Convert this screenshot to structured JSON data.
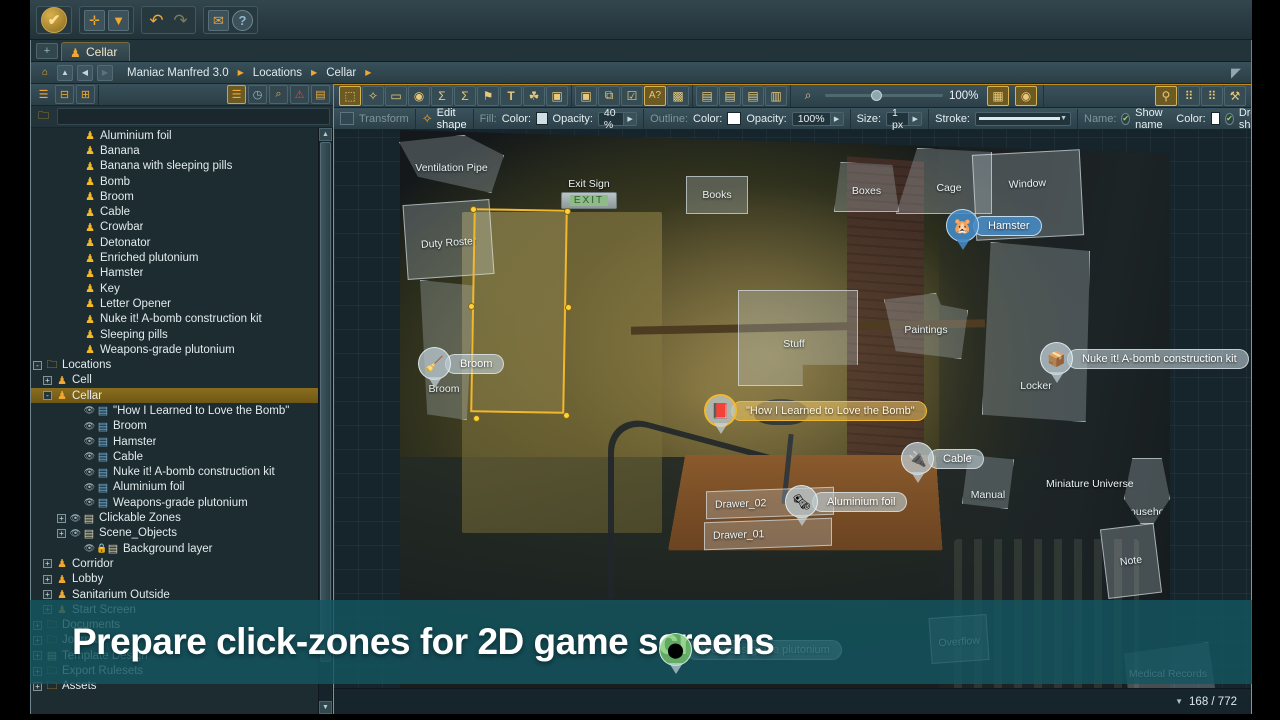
{
  "titlebar": {
    "buttons": [
      {
        "name": "apply-button",
        "glyph": "✔"
      },
      {
        "name": "new-button",
        "glyph": "✚"
      },
      {
        "name": "save-button",
        "glyph": "▼"
      },
      {
        "name": "undo-button",
        "glyph": "↶"
      },
      {
        "name": "redo-button",
        "glyph": "↷"
      },
      {
        "name": "mail-button",
        "glyph": "✉"
      },
      {
        "name": "help-button",
        "glyph": "?"
      }
    ]
  },
  "tabs": {
    "add_label": "+",
    "items": [
      {
        "label": "Cellar",
        "active": true
      }
    ]
  },
  "breadcrumb": {
    "home": "⌂",
    "up": "▲",
    "back": "◀",
    "forward": "▶",
    "segments": [
      "Maniac Manfred 3.0",
      "Locations",
      "Cellar"
    ],
    "arrow": "▶",
    "right_icon": "signal-icon"
  },
  "left_panel": {
    "toolbar_left": [
      "list-indent-icon",
      "list-collapse-icon",
      "list-expand-icon"
    ],
    "toolbar_right": [
      {
        "name": "filter-list-icon",
        "glyph": "☰",
        "selected": true
      },
      {
        "name": "clock-icon",
        "glyph": "◷",
        "selected": false
      },
      {
        "name": "search-icon",
        "glyph": "🔍",
        "selected": false
      },
      {
        "name": "warning-icon",
        "glyph": "⚠",
        "selected": false
      },
      {
        "name": "grid-icon",
        "glyph": "▤",
        "selected": false
      }
    ],
    "row2_icon": "folder-icon",
    "tree": [
      {
        "label": "Aluminium foil",
        "indent": 3,
        "icon": "item",
        "toggle": "none"
      },
      {
        "label": "Banana",
        "indent": 3,
        "icon": "item",
        "toggle": "none"
      },
      {
        "label": "Banana with sleeping pills",
        "indent": 3,
        "icon": "item",
        "toggle": "none"
      },
      {
        "label": "Bomb",
        "indent": 3,
        "icon": "item",
        "toggle": "none"
      },
      {
        "label": "Broom",
        "indent": 3,
        "icon": "item",
        "toggle": "none"
      },
      {
        "label": "Cable",
        "indent": 3,
        "icon": "item",
        "toggle": "none"
      },
      {
        "label": "Crowbar",
        "indent": 3,
        "icon": "item",
        "toggle": "none"
      },
      {
        "label": "Detonator",
        "indent": 3,
        "icon": "item",
        "toggle": "none"
      },
      {
        "label": "Enriched plutonium",
        "indent": 3,
        "icon": "item",
        "toggle": "none"
      },
      {
        "label": "Hamster",
        "indent": 3,
        "icon": "item",
        "toggle": "none"
      },
      {
        "label": "Key",
        "indent": 3,
        "icon": "item",
        "toggle": "none"
      },
      {
        "label": "Letter Opener",
        "indent": 3,
        "icon": "item",
        "toggle": "none"
      },
      {
        "label": "Nuke it! A-bomb construction kit",
        "indent": 3,
        "icon": "item",
        "toggle": "none"
      },
      {
        "label": "Sleeping pills",
        "indent": 3,
        "icon": "item",
        "toggle": "none"
      },
      {
        "label": "Weapons-grade plutonium",
        "indent": 3,
        "icon": "item",
        "toggle": "none"
      },
      {
        "label": "Locations",
        "indent": 0,
        "icon": "folder",
        "toggle": "-"
      },
      {
        "label": "Cell",
        "indent": 1,
        "icon": "loc",
        "toggle": "+"
      },
      {
        "label": "Cellar",
        "indent": 1,
        "icon": "loc",
        "toggle": "-",
        "selected": true
      },
      {
        "label": "\"How I Learned to Love the Bomb\"",
        "indent": 3,
        "icon": "zone",
        "toggle": "none",
        "eye": true
      },
      {
        "label": "Broom",
        "indent": 3,
        "icon": "zone",
        "toggle": "none",
        "eye": true
      },
      {
        "label": "Hamster",
        "indent": 3,
        "icon": "zone",
        "toggle": "none",
        "eye": true
      },
      {
        "label": "Cable",
        "indent": 3,
        "icon": "zone",
        "toggle": "none",
        "eye": true
      },
      {
        "label": "Nuke it! A-bomb construction kit",
        "indent": 3,
        "icon": "zone",
        "toggle": "none",
        "eye": true
      },
      {
        "label": "Aluminium foil",
        "indent": 3,
        "icon": "zone",
        "toggle": "none",
        "eye": true
      },
      {
        "label": "Weapons-grade plutonium",
        "indent": 3,
        "icon": "zone",
        "toggle": "none",
        "eye": true
      },
      {
        "label": "Clickable Zones",
        "indent": 2,
        "icon": "layer",
        "toggle": "+",
        "eye": true
      },
      {
        "label": "Scene_Objects",
        "indent": 2,
        "icon": "layer",
        "toggle": "+",
        "eye": true
      },
      {
        "label": "Background layer",
        "indent": 3,
        "icon": "layer",
        "toggle": "none",
        "eye": true,
        "lock": true
      },
      {
        "label": "Corridor",
        "indent": 1,
        "icon": "loc",
        "toggle": "+"
      },
      {
        "label": "Lobby",
        "indent": 1,
        "icon": "loc",
        "toggle": "+"
      },
      {
        "label": "Sanitarium Outside",
        "indent": 1,
        "icon": "loc",
        "toggle": "+"
      },
      {
        "label": "Start Screen",
        "indent": 1,
        "icon": "loc",
        "toggle": "+"
      },
      {
        "label": "Documents",
        "indent": 0,
        "icon": "folder",
        "toggle": "+"
      },
      {
        "label": "Journal",
        "indent": 0,
        "icon": "folder",
        "toggle": "+"
      },
      {
        "label": "Template Design",
        "indent": 0,
        "icon": "layer",
        "toggle": "+"
      },
      {
        "label": "Export Rulesets",
        "indent": 0,
        "icon": "folder",
        "toggle": "+"
      },
      {
        "label": "Assets",
        "indent": 0,
        "icon": "folder",
        "toggle": "+"
      }
    ]
  },
  "canvas_toolbar": {
    "tools": [
      {
        "name": "select-tool",
        "glyph": "⬚",
        "selected": true
      },
      {
        "name": "polygon-tool",
        "glyph": "✦"
      },
      {
        "name": "rectangle-tool",
        "glyph": "▭"
      },
      {
        "name": "ellipse-tool",
        "glyph": "◉"
      },
      {
        "name": "path-tool",
        "glyph": "Σ"
      },
      {
        "name": "bezier-tool",
        "glyph": "Σ"
      },
      {
        "name": "hotspot-tool",
        "glyph": "⚑"
      },
      {
        "name": "text-tool",
        "glyph": "T"
      },
      {
        "name": "scene-object-tool",
        "glyph": "☘"
      },
      {
        "name": "image-tool",
        "glyph": "🖼"
      }
    ],
    "actions": [
      {
        "name": "align-icon",
        "glyph": "▣"
      },
      {
        "name": "group-icon",
        "glyph": "⧉"
      },
      {
        "name": "validate-icon",
        "glyph": "☑"
      },
      {
        "name": "rename-icon",
        "glyph": "A?",
        "selected": true
      },
      {
        "name": "preview-icon",
        "glyph": "🏞"
      }
    ],
    "layers": [
      {
        "name": "layer-icon",
        "glyph": "▤"
      },
      {
        "name": "layer-up-icon",
        "glyph": "▤"
      },
      {
        "name": "layer-down-icon",
        "glyph": "▤"
      },
      {
        "name": "layer-duplicate-icon",
        "glyph": "▥"
      }
    ],
    "zoom": {
      "icon": "zoom-icon",
      "value": "100%",
      "toggles": [
        {
          "name": "show-grid-icon",
          "glyph": "▦",
          "selected": true
        },
        {
          "name": "show-hotspots-icon",
          "glyph": "◉",
          "selected": true
        }
      ]
    },
    "right_buttons": [
      {
        "name": "items-panel-icon",
        "glyph": "🗝",
        "selected": true
      },
      {
        "name": "properties-panel-icon",
        "glyph": "⠿"
      },
      {
        "name": "grid-panel-icon",
        "glyph": "⠿"
      },
      {
        "name": "tools-panel-icon",
        "glyph": "🔧"
      }
    ]
  },
  "properties_bar": {
    "transform_label": "Transform",
    "edit_shape_label": "Edit shape",
    "fill_label": "Fill:",
    "fill_color_label": "Color:",
    "fill_color": "#cfdfe4",
    "fill_opacity_label": "Opacity:",
    "fill_opacity": "40 %",
    "outline_label": "Outline:",
    "outline_color_label": "Color:",
    "outline_color": "#ffffff",
    "outline_opacity_label": "Opacity:",
    "outline_opacity": "100%",
    "size_label": "Size:",
    "size_value": "1 px",
    "stroke_label": "Stroke:",
    "name_label": "Name:",
    "show_name_label": "Show name",
    "name_color_label": "Color:",
    "name_color": "#ffffff",
    "drop_shadow_label": "Drop shadow"
  },
  "canvas": {
    "zones": [
      {
        "name": "ventilation-pipe",
        "label": "Ventilation Pipe"
      },
      {
        "name": "duty-roster",
        "label": "Duty Roster"
      },
      {
        "name": "exit-sign",
        "label": "Exit Sign",
        "sign_text": "EXIT"
      },
      {
        "name": "broom-zone",
        "label": "Broom"
      },
      {
        "name": "door-zone",
        "label": "",
        "selected": true
      },
      {
        "name": "books",
        "label": "Books"
      },
      {
        "name": "boxes",
        "label": "Boxes"
      },
      {
        "name": "cage",
        "label": "Cage"
      },
      {
        "name": "window",
        "label": "Window"
      },
      {
        "name": "stuff",
        "label": "Stuff"
      },
      {
        "name": "paintings",
        "label": "Paintings"
      },
      {
        "name": "locker",
        "label": "Locker"
      },
      {
        "name": "miniature-universe",
        "label": "Miniature Universe"
      },
      {
        "name": "manual",
        "label": "Manual"
      },
      {
        "name": "mousehole",
        "label": "Mousehole"
      },
      {
        "name": "note",
        "label": "Note"
      },
      {
        "name": "drawer-02",
        "label": "Drawer_02"
      },
      {
        "name": "drawer-01",
        "label": "Drawer_01"
      },
      {
        "name": "overflow",
        "label": "Overflow"
      },
      {
        "name": "medical-records",
        "label": "Medical Records"
      }
    ],
    "pins": [
      {
        "name": "pin-hamster",
        "label": "Hamster",
        "glyph": "🐹",
        "style": "blue"
      },
      {
        "name": "pin-broom",
        "label": "Broom",
        "glyph": "🧹",
        "style": "grey"
      },
      {
        "name": "pin-bomb-book",
        "label": "\"How I Learned to Love the Bomb\"",
        "glyph": "📕",
        "style": "selected"
      },
      {
        "name": "pin-nuke-kit",
        "label": "Nuke it! A-bomb construction kit",
        "glyph": "📦",
        "style": "grey"
      },
      {
        "name": "pin-cable",
        "label": "Cable",
        "glyph": "🔌",
        "style": "grey"
      },
      {
        "name": "pin-aluminium-foil",
        "label": "Aluminium foil",
        "glyph": "🗞",
        "style": "grey"
      },
      {
        "name": "pin-plutonium",
        "label": "Weapons-grade plutonium",
        "glyph": "🟢",
        "style": "grey"
      }
    ]
  },
  "statusbar": {
    "dropdown": "▼",
    "counter": "168 / 772"
  },
  "banner": {
    "text": "Prepare click-zones for 2D game screens",
    "color": "#145660"
  }
}
